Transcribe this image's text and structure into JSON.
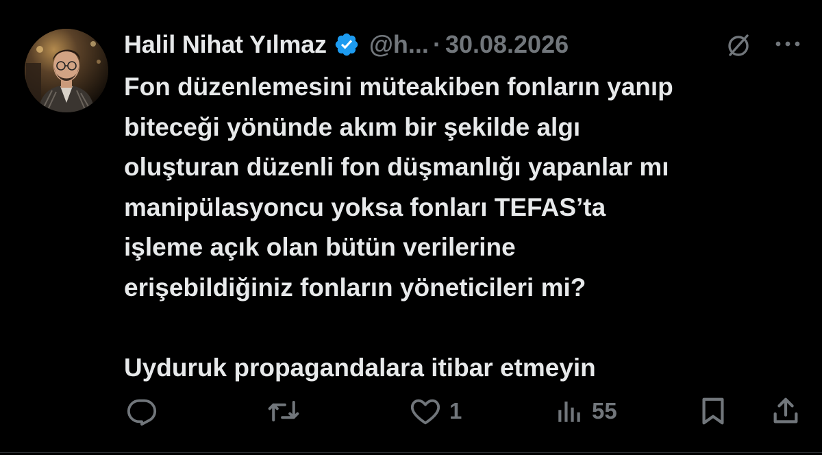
{
  "tweet": {
    "author": {
      "name": "Halil Nihat Yılmaz",
      "handle": "@h...",
      "verified": true
    },
    "separator": "·",
    "date": "30.08.2026",
    "text_lines": [
      "Fon düzenlemesini müteakiben fonların yanıp",
      "biteceği yönünde akım bir şekilde algı",
      "oluşturan düzenli fon düşmanlığı yapanlar mı",
      "manipülasyoncu yoksa fonları TEFAS’ta",
      "işleme açık olan bütün verilerine",
      "erişebildiğiniz fonların yöneticileri mi?"
    ],
    "text_final": "Uyduruk propagandalara itibar etmeyin",
    "metrics": {
      "likes": "1",
      "views": "55"
    }
  },
  "icons": {
    "verified": "verified-badge-icon",
    "grok": "grok-icon",
    "more": "more-icon",
    "reply": "reply-icon",
    "retweet": "retweet-icon",
    "like": "heart-icon",
    "views": "views-icon",
    "bookmark": "bookmark-icon",
    "share": "share-icon"
  },
  "colors": {
    "background": "#000000",
    "text": "#e7e9ea",
    "muted": "#71767b",
    "verified": "#1d9bf0"
  }
}
